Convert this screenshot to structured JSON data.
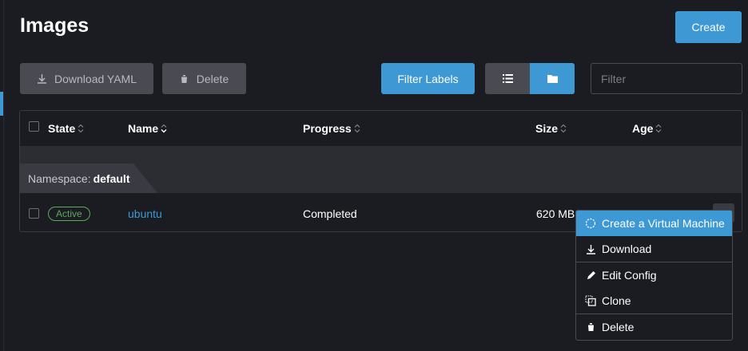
{
  "page": {
    "title": "Images"
  },
  "toolbar": {
    "create_label": "Create",
    "download_yaml_label": "Download YAML",
    "delete_label": "Delete",
    "filter_labels_label": "Filter Labels",
    "filter_placeholder": "Filter",
    "filter_value": ""
  },
  "table": {
    "headers": {
      "state": "State",
      "name": "Name",
      "progress": "Progress",
      "size": "Size",
      "age": "Age"
    },
    "group": {
      "namespace_label": "Namespace:",
      "namespace_value": "default"
    },
    "rows": [
      {
        "state": "Active",
        "name": "ubuntu",
        "progress": "Completed",
        "size": "620 MB"
      }
    ]
  },
  "context_menu": {
    "items": [
      {
        "label": "Create a Virtual Machine",
        "icon": "spinner-icon",
        "active": true
      },
      {
        "label": "Download",
        "icon": "download-icon"
      },
      {
        "label": "Edit Config",
        "icon": "pencil-icon"
      },
      {
        "label": "Clone",
        "icon": "clone-icon"
      },
      {
        "label": "Delete",
        "icon": "trash-icon"
      }
    ]
  },
  "colors": {
    "background": "#1b1c21",
    "accent": "#3d98d3",
    "button_gray": "#4a4b52",
    "status_active": "#5da95d"
  }
}
